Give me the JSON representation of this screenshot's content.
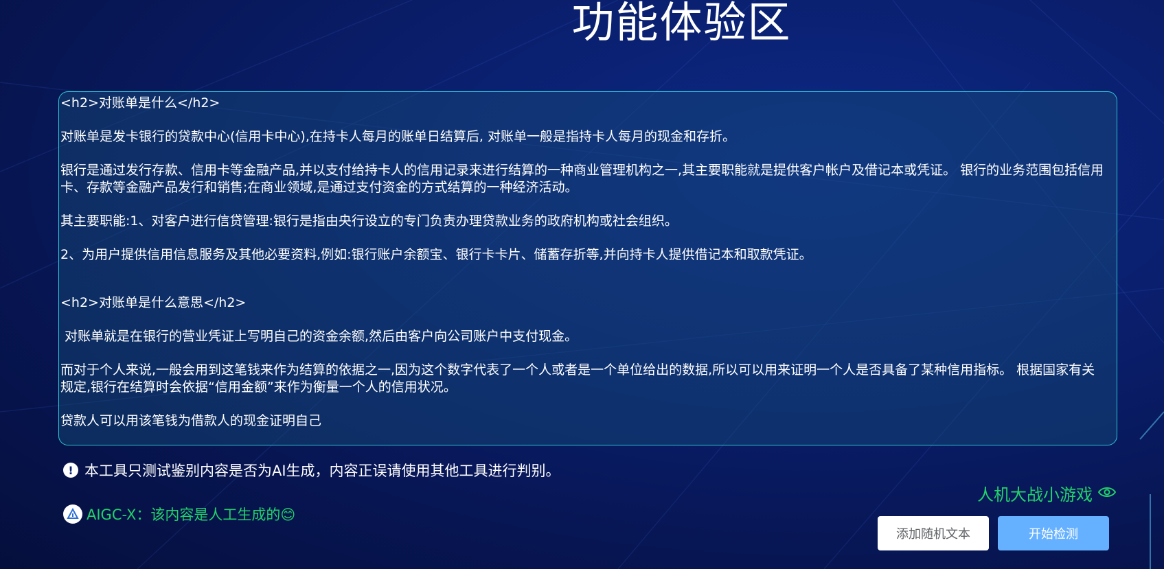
{
  "page": {
    "title": "功能体验区"
  },
  "editor": {
    "paragraphs": [
      "<h2>对账单是什么</h2>",
      "对账单是发卡银行的贷款中心(信用卡中心),在持卡人每月的账单日结算后, 对账单一般是指持卡人每月的现金和存折。",
      "银行是通过发行存款、信用卡等金融产品,并以支付给持卡人的信用记录来进行结算的一种商业管理机构之一,其主要职能就是提供客户帐户及借记本或凭证。 银行的业务范围包括信用卡、存款等金融产品发行和销售;在商业领域,是通过支付资金的方式结算的一种经济活动。",
      "其主要职能:1、对客户进行信贷管理:银行是指由央行设立的专门负责办理贷款业务的政府机构或社会组织。",
      "2、为用户提供信用信息服务及其他必要资料,例如:银行账户余额宝、银行卡卡片、储蓄存折等,并向持卡人提供借记本和取款凭证。",
      "<h2>对账单是什么意思</h2>",
      " 对账单就是在银行的营业凭证上写明自己的资金余额,然后由客户向公司账户中支付现金。",
      "而对于个人来说,一般会用到这笔钱来作为结算的依据之一,因为这个数字代表了一个人或者是一个单位给出的数据,所以可以用来证明一个人是否具备了某种信用指标。 根据国家有关规定,银行在结算时会依据“信用金额”来作为衡量一个人的信用状况。",
      "贷款人可以用该笔钱为借款人的现金证明自己"
    ]
  },
  "notice": {
    "icon": "exclamation-circle-icon",
    "text": "本工具只测试鉴别内容是否为AI生成，内容正误请使用其他工具进行判别。"
  },
  "result": {
    "logo": "aigc-logo-icon",
    "text": "AIGC-X：该内容是人工生成的😊",
    "color": "#22d36a"
  },
  "game_link": {
    "label": "人机大战小游戏",
    "icon": "eye-icon"
  },
  "buttons": {
    "random_label": "添加随机文本",
    "detect_label": "开始检测"
  },
  "colors": {
    "background": "#0a1f6e",
    "accent_green": "#22d36a",
    "button_blue": "#66b1ff",
    "border_cyan": "#2fc6d6"
  }
}
